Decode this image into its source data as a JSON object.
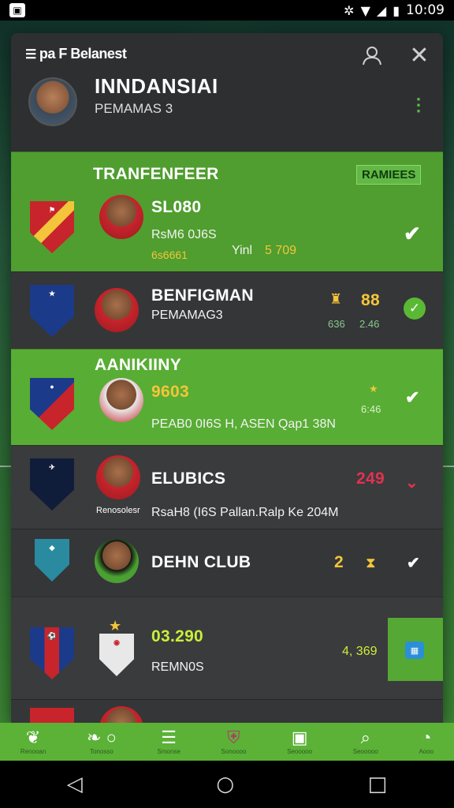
{
  "status_bar": {
    "time": "10:09",
    "icons": [
      "app-icon",
      "vibrate-icon",
      "wifi-icon",
      "signal-icon",
      "battery-icon"
    ]
  },
  "header": {
    "brand": "pa F Belanest",
    "player_name": "INNDANSIAI",
    "player_subtitle": "PEMAMAS 3"
  },
  "transfer": {
    "title": "TRANFENFEER",
    "badge": "RAMIEES",
    "club_name": "SL080",
    "detail_left": "RsM6 0J6S",
    "detail_value": "6s6661",
    "detail_right": "Yinl",
    "stat_yellow": "5 709"
  },
  "rows": [
    {
      "name": "BENFIGMAN",
      "subtitle": "PEMAMAG3",
      "stat_top": "88",
      "stat_a": "636",
      "stat_b": "2.46"
    },
    {
      "section": "AANIKIINY",
      "value": "9603",
      "detail": "PEAB0 0I6S H, ASEN Qap1 38N",
      "small": "6:46"
    },
    {
      "name": "ELUBICS",
      "number": "249",
      "avatar_caption": "Renosolesr",
      "detail": "RsaH8 (I6S Pallan.Ralp Ke 204M"
    },
    {
      "name": "DEHN CLUB",
      "number": "2"
    },
    {
      "value": "03.290",
      "subtitle": "REMN0S",
      "right_value": "4, 369"
    }
  ],
  "bottom_nav": [
    {
      "icon": "leaf-icon",
      "label": "Renooan"
    },
    {
      "icon": "pepper-icon",
      "label": "Tonosso"
    },
    {
      "icon": "list-icon",
      "label": "Smonse"
    },
    {
      "icon": "shield-icon",
      "label": "Sonoooo"
    },
    {
      "icon": "store-icon",
      "label": "Seooooo"
    },
    {
      "icon": "search-icon",
      "label": "Seooooo"
    },
    {
      "icon": "timer-icon",
      "label": "Aooo"
    }
  ],
  "colors": {
    "accent_green": "#4f9e2f",
    "panel_dark": "#2f3032",
    "yellow": "#f3c53a",
    "red": "#e0334e"
  }
}
